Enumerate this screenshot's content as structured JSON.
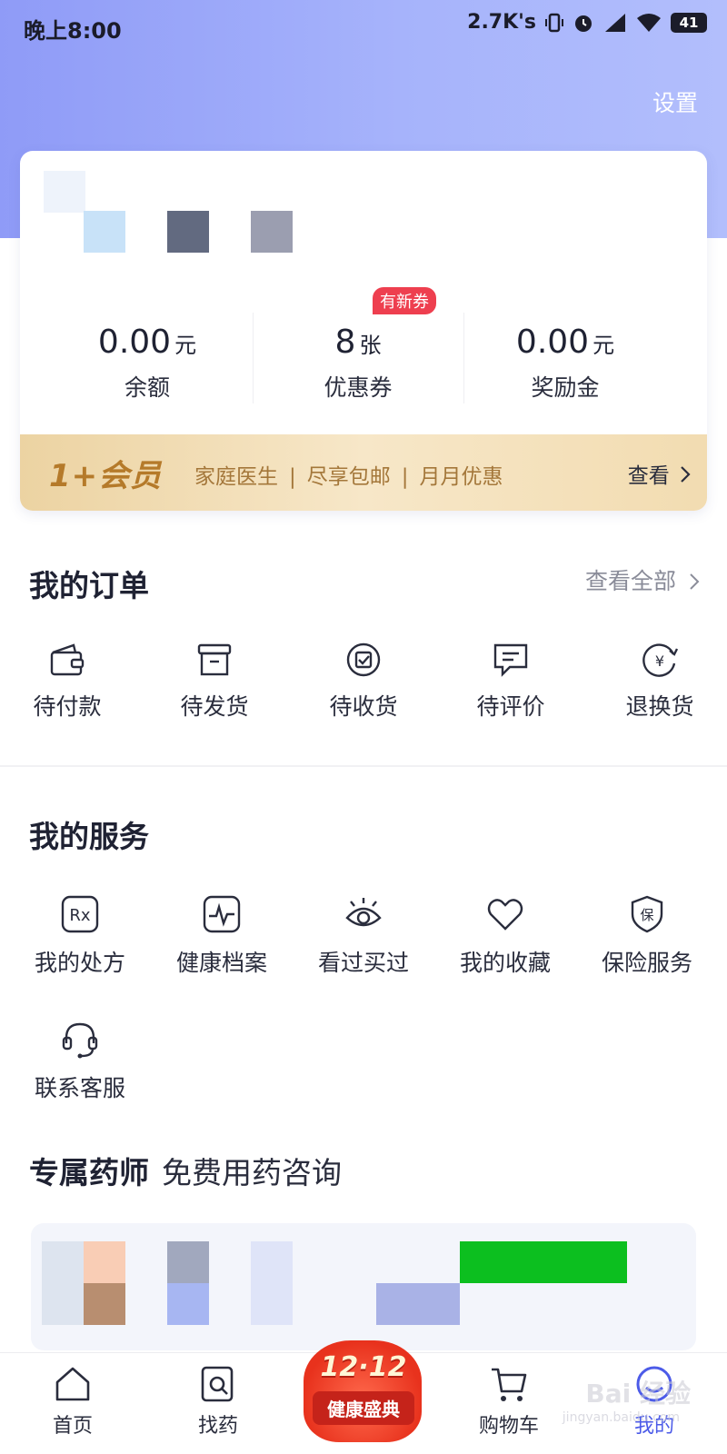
{
  "status_bar": {
    "time": "晚上8:00",
    "net_speed": "2.7K's",
    "battery": "41"
  },
  "header": {
    "settings_label": "设置",
    "gradient_start": "#8f9bf7",
    "gradient_end": "#b2befc"
  },
  "profile": {
    "stats": [
      {
        "value": "0.00",
        "unit": "元",
        "label": "余额"
      },
      {
        "value": "8",
        "unit": "张",
        "label": "优惠券"
      },
      {
        "value": "0.00",
        "unit": "元",
        "label": "奖励金"
      }
    ],
    "coupon_badge": "有新券",
    "badge_color": "#ee3f4f"
  },
  "membership": {
    "logo": "1+会员",
    "benefits": [
      "家庭医生",
      "尽享包邮",
      "月月优惠"
    ],
    "view_label": "查看"
  },
  "orders": {
    "title": "我的订单",
    "view_all": "查看全部",
    "items": [
      {
        "label": "待付款",
        "icon": "wallet-icon"
      },
      {
        "label": "待发货",
        "icon": "box-icon"
      },
      {
        "label": "待收货",
        "icon": "delivery-icon"
      },
      {
        "label": "待评价",
        "icon": "comment-icon"
      },
      {
        "label": "退换货",
        "icon": "refund-icon"
      }
    ]
  },
  "services": {
    "title": "我的服务",
    "items": [
      {
        "label": "我的处方",
        "icon": "rx-icon"
      },
      {
        "label": "健康档案",
        "icon": "health-record-icon"
      },
      {
        "label": "看过买过",
        "icon": "eye-icon"
      },
      {
        "label": "我的收藏",
        "icon": "heart-icon"
      },
      {
        "label": "保险服务",
        "icon": "shield-icon"
      },
      {
        "label": "联系客服",
        "icon": "headset-icon"
      }
    ]
  },
  "pharmacist": {
    "title": "专属药师",
    "subtitle": "免费用药咨询"
  },
  "tabbar": {
    "items": [
      {
        "label": "首页",
        "icon": "home-icon"
      },
      {
        "label": "找药",
        "icon": "find-medicine-icon"
      },
      {
        "label": "购物车",
        "icon": "cart-icon"
      },
      {
        "label": "我的",
        "icon": "profile-icon"
      }
    ],
    "active_color": "#4c5be8",
    "promo": {
      "date": "12·12",
      "name": "健康盛典"
    }
  },
  "watermark": {
    "text": "Bai 经验",
    "url": "jingyan.baidu.com"
  }
}
